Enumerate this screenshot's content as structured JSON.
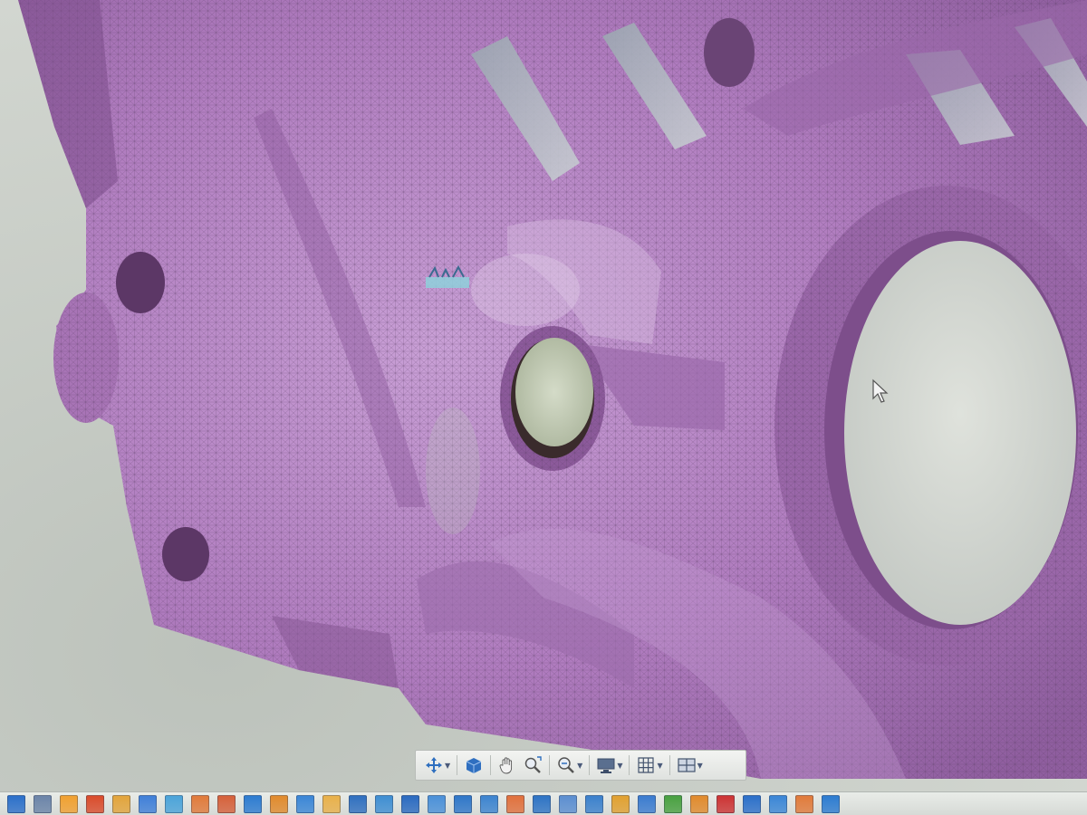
{
  "app": {
    "view": "mesh-viewport",
    "model_color": "#b784c3",
    "background_color": "#c9cec8"
  },
  "navigation_toolbar": {
    "items": [
      {
        "name": "pan",
        "icon": "pan-arrows-icon",
        "has_dropdown": true
      },
      {
        "name": "view-cube",
        "icon": "cube-icon",
        "has_dropdown": false
      },
      {
        "name": "orbit",
        "icon": "hand-icon",
        "has_dropdown": false
      },
      {
        "name": "zoom-window",
        "icon": "zoom-window-icon",
        "has_dropdown": false
      },
      {
        "name": "zoom",
        "icon": "zoom-icon",
        "has_dropdown": true
      },
      {
        "name": "display-settings",
        "icon": "monitor-icon",
        "has_dropdown": true
      },
      {
        "name": "grid-settings",
        "icon": "grid-icon",
        "has_dropdown": true
      },
      {
        "name": "viewports",
        "icon": "viewports-icon",
        "has_dropdown": true
      }
    ]
  },
  "ribbon": {
    "icon_colors": [
      "#2b6fc9",
      "#6b84a8",
      "#f0a030",
      "#d94b2b",
      "#e2a43b",
      "#3f7fd8",
      "#4aa3d9",
      "#e07a3a",
      "#d5603a",
      "#2c7bd0",
      "#e08a2c",
      "#3a86d6",
      "#e8b04a",
      "#2f6fbf",
      "#3e8ed2",
      "#2a6ac0",
      "#4a90d8",
      "#2e76c8",
      "#3c84cf",
      "#e0703c",
      "#2d73c4",
      "#5b8ed0",
      "#3a80cc",
      "#e0a030",
      "#3a7bcf",
      "#48a040",
      "#e08a2c",
      "#cc3333",
      "#2b6fc9",
      "#3a86d6",
      "#e07a3a",
      "#2c7bd0"
    ]
  }
}
